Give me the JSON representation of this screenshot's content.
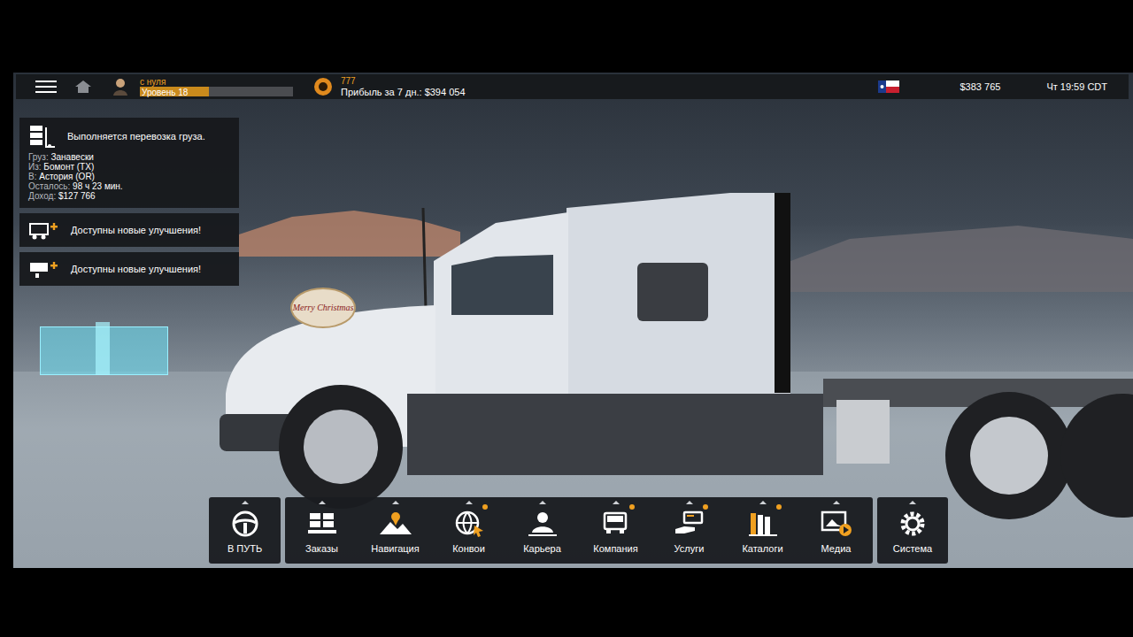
{
  "topbar": {
    "profile": {
      "name": "с нуля",
      "level_label": "Уровень 18",
      "level": 0.45
    },
    "points": "777",
    "profit": "Прибыль за 7 дн.: $394 054",
    "balance": "$383 765",
    "clock": "Чт 19:59 CDT"
  },
  "job": {
    "title": "Выполняется перевозка груза.",
    "fields": [
      {
        "label": "Груз:",
        "value": "Занавески"
      },
      {
        "label": "Из:",
        "value": "Бомонт (TX)"
      },
      {
        "label": "В:",
        "value": "Астория (OR)"
      },
      {
        "label": "Осталось:",
        "value": "98 ч 23 мин."
      },
      {
        "label": "Доход:",
        "value": "$127 766"
      }
    ]
  },
  "notifications": [
    {
      "text": "Доступны новые улучшения!",
      "kind": "truck"
    },
    {
      "text": "Доступны новые улучшения!",
      "kind": "trailer"
    }
  ],
  "scene": {
    "badge": "Merry Christmas"
  },
  "menu": [
    {
      "label": "В ПУТЬ",
      "kind": "drive",
      "notify": false
    },
    {
      "label": "Заказы",
      "kind": "orders",
      "notify": false
    },
    {
      "label": "Навигация",
      "kind": "navigation",
      "notify": false
    },
    {
      "label": "Конвои",
      "kind": "convoy",
      "notify": true
    },
    {
      "label": "Карьера",
      "kind": "career",
      "notify": false
    },
    {
      "label": "Компания",
      "kind": "company",
      "notify": true
    },
    {
      "label": "Услуги",
      "kind": "services",
      "notify": true
    },
    {
      "label": "Каталоги",
      "kind": "catalogs",
      "notify": true
    },
    {
      "label": "Медиа",
      "kind": "media",
      "notify": false
    },
    {
      "label": "Система",
      "kind": "system",
      "notify": false
    }
  ]
}
